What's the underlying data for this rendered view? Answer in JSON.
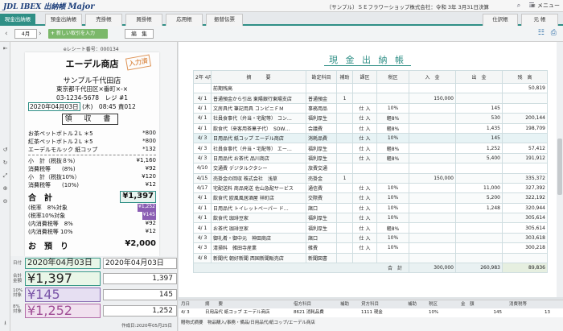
{
  "app": {
    "logo": "JDL IBEX 出納帳",
    "logo_major": "Major",
    "company": "（サンプル）ＳＥフラワーショップ株式会社：令和 3年 3月31日決算",
    "menu_label": "メニュー"
  },
  "tabs": [
    {
      "label": "現金出納帳",
      "active": true
    },
    {
      "label": "預金出納帳"
    },
    {
      "label": "売掛帳"
    },
    {
      "label": "買掛帳"
    },
    {
      "label": "応用帳"
    },
    {
      "label": "振替伝票"
    },
    {
      "label": "仕訳帳"
    },
    {
      "label": "元 帳"
    }
  ],
  "toolbar": {
    "month": "4月",
    "new_button": "新しい取引を入力",
    "edit_button": "編　集"
  },
  "receipt": {
    "number_label": "eレシート番号：000134",
    "store": "エーデル商店",
    "stamp": "入力済",
    "branch": "サンプル千代田店",
    "address": "東京都千代田区×番町×-×",
    "tel": "03-1234-5678　レジ #1",
    "date": "2020年04月03日",
    "date_rest": "(木)　08:45 責012",
    "title": "領 収 書",
    "items": [
      {
        "name": "お茶ペットボトル２L ＊5",
        "price": "*800"
      },
      {
        "name": "紅茶ペットボトル２L ＊5",
        "price": "*800"
      },
      {
        "name": "エーデルモルック 紙コップ",
        "price": "*132"
      }
    ],
    "subtotal8_label": "小　計（税抜８%）",
    "subtotal8": "¥1,160",
    "tax8_label": "消費税等　　(8%)",
    "tax8": "¥92",
    "subtotal10_label": "小　計（税抜10%）",
    "subtotal10": "¥120",
    "tax10_label": "消費税等　　(10%)",
    "tax10": "¥12",
    "total_label": "合　計",
    "total": "¥1,397",
    "t8_label": "(税率　8%対象",
    "t8": "¥1,252",
    "t10_label": "(税率10%対象",
    "t10": "¥145",
    "in8_label": "(内消費税等　8%",
    "in8": "¥92",
    "in10_label": "(内消費税等 10%",
    "in10": "¥12",
    "paid_label": "お　預　り",
    "paid": "¥2,000"
  },
  "fields": {
    "date_label": "日付",
    "date_value": "2020年04月03日",
    "date_value2": "2020年04月03日",
    "total_label": "合計金額",
    "total_value": "¥1,397",
    "total_value2": "1,397",
    "rate10_label": "10%対象",
    "rate10_value": "¥145",
    "rate10_value2": "145",
    "rate8_label": "8%対象",
    "rate8_value": "¥1,252",
    "rate8_value2": "1,252",
    "footer": "作成日:2020年05月25日"
  },
  "ledger": {
    "title": "現 金 出 納 帳",
    "headers": [
      "2年\n4月",
      "摘　　　要",
      "勘定科目",
      "補助",
      "課区",
      "税区",
      "入　金",
      "出　金",
      "残　高"
    ],
    "rows": [
      [
        "",
        "前期残高",
        "",
        "",
        "",
        "",
        "",
        "",
        "50,819"
      ],
      [
        "4/ 1",
        "普通預金から引出 東陽銀行東陽支店",
        "普通預金",
        "1",
        "",
        "",
        "150,000",
        "",
        ""
      ],
      [
        "4/ 1",
        "文房具代 筆記用具 コンピニＦＭ",
        "事務用品",
        "",
        "仕 入",
        "10%",
        "",
        "145",
        ""
      ],
      [
        "4/ 1",
        "社員食事代（弁当・宅配等） コン…",
        "福利厚生",
        "",
        "仕 入",
        "軽8%",
        "",
        "530",
        "200,144"
      ],
      [
        "4/ 1",
        "飲食代（来客用茶菓子代）　SOW…",
        "会議費",
        "",
        "仕 入",
        "軽8%",
        "",
        "1,435",
        "198,709"
      ],
      [
        "4/ 3",
        "日用品代 紙コップ エーデル商店",
        "消耗品費",
        "",
        "仕 入",
        "10%",
        "",
        "145",
        ""
      ],
      [
        "4/ 3",
        "社員食事代（弁当・宅配等） エー…",
        "福利厚生",
        "",
        "仕 入",
        "軽8%",
        "",
        "1,252",
        "57,412"
      ],
      [
        "4/ 3",
        "日用品代 お茶代 品川商店",
        "福利厚生",
        "",
        "仕 入",
        "軽8%",
        "",
        "5,400",
        "191,912"
      ],
      [
        "4/10",
        "交通費 デジタルクタシー",
        "旅費交通",
        "",
        "",
        "",
        "",
        "",
        ""
      ],
      [
        "4/15",
        "売掛金の回収 株式会社　浅草",
        "売掛金",
        "1",
        "",
        "",
        "150,000",
        "",
        "335,372"
      ],
      [
        "4/17",
        "宅配送料 商品発送 佐山急配サービス",
        "通信費",
        "",
        "仕 入",
        "10%",
        "",
        "11,000",
        "327,392"
      ],
      [
        "4/ 1",
        "飲食代 欧風風居酒屋 祥町店",
        "交際費",
        "",
        "仕 入",
        "10%",
        "",
        "5,200",
        "322,192"
      ],
      [
        "4/ 1",
        "日用品代 トイレットペーパー ド…",
        "諸口",
        "",
        "仕 入",
        "10%",
        "",
        "1,248",
        "320,944"
      ],
      [
        "4/ 1",
        "飲食代 珈琲豆家",
        "福利厚生",
        "",
        "仕 入",
        "10%",
        "",
        "",
        "305,614"
      ],
      [
        "4/ 1",
        "お茶代 珈琲豆家",
        "福利厚生",
        "",
        "仕 入",
        "軽8%",
        "",
        "",
        "305,614"
      ],
      [
        "4/ 3",
        "御礼肴・御中元　神田商店",
        "諸口",
        "",
        "仕 入",
        "10%",
        "",
        "",
        "303,618"
      ],
      [
        "4/ 3",
        "清掃料　雑田寺産業",
        "雑費",
        "",
        "仕 入",
        "10%",
        "",
        "",
        "300,218"
      ],
      [
        "4/ 8",
        "新聞代 朝好新聞 西国新聞販売店",
        "新聞図書",
        "",
        "",
        "",
        "",
        "",
        ""
      ]
    ],
    "sum_label": "合　計",
    "sum_in": "300,000",
    "sum_out": "260,983",
    "sum_bal": "89,836"
  },
  "detail": {
    "headers": [
      "月日",
      "摘　　要",
      "借方科目",
      "補助",
      "貸方科目",
      "補助",
      "税区",
      "金　額",
      "消費税等"
    ],
    "row": [
      "4/ 3",
      "日用品代 紙コップ エーデル商店",
      "8621 消耗品費",
      "",
      "1111 現金",
      "",
      "10%",
      "145",
      "13"
    ],
    "extra": "贈物式摘要　物品購入/事務・備品/日用品代/紙コップ/エーデル商店"
  }
}
